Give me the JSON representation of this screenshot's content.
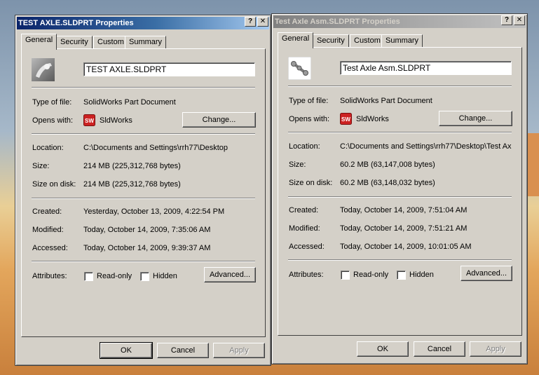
{
  "dialogs": [
    {
      "title": "TEST AXLE.SLDPRT Properties",
      "active": true,
      "tabs": [
        "General",
        "Security",
        "Custom",
        "Summary"
      ],
      "file_name": "TEST AXLE.SLDPRT",
      "file_icon": "part-thumbnail-icon",
      "type_label": "Type of file:",
      "type_value": "SolidWorks Part Document",
      "opens_label": "Opens with:",
      "opens_value": "SldWorks",
      "change_label": "Change...",
      "location_label": "Location:",
      "location_value": "C:\\Documents and Settings\\rrh77\\Desktop",
      "size_label": "Size:",
      "size_value": "214 MB (225,312,768 bytes)",
      "size_disk_label": "Size on disk:",
      "size_disk_value": "214 MB (225,312,768 bytes)",
      "created_label": "Created:",
      "created_value": "Yesterday, October 13, 2009, 4:22:54 PM",
      "modified_label": "Modified:",
      "modified_value": "Today, October 14, 2009, 7:35:06 AM",
      "accessed_label": "Accessed:",
      "accessed_value": "Today, October 14, 2009, 9:39:37 AM",
      "attributes_label": "Attributes:",
      "readonly_label": "Read-only",
      "hidden_label": "Hidden",
      "advanced_label": "Advanced...",
      "ok_label": "OK",
      "cancel_label": "Cancel",
      "apply_label": "Apply"
    },
    {
      "title": "Test Axle Asm.SLDPRT Properties",
      "active": false,
      "tabs": [
        "General",
        "Security",
        "Custom",
        "Summary"
      ],
      "file_name": "Test Axle Asm.SLDPRT",
      "file_icon": "assembly-thumbnail-icon",
      "type_label": "Type of file:",
      "type_value": "SolidWorks Part Document",
      "opens_label": "Opens with:",
      "opens_value": "SldWorks",
      "change_label": "Change...",
      "location_label": "Location:",
      "location_value": "C:\\Documents and Settings\\rrh77\\Desktop\\Test Ax",
      "size_label": "Size:",
      "size_value": "60.2 MB (63,147,008 bytes)",
      "size_disk_label": "Size on disk:",
      "size_disk_value": "60.2 MB (63,148,032 bytes)",
      "created_label": "Created:",
      "created_value": "Today, October 14, 2009, 7:51:04 AM",
      "modified_label": "Modified:",
      "modified_value": "Today, October 14, 2009, 7:51:21 AM",
      "accessed_label": "Accessed:",
      "accessed_value": "Today, October 14, 2009, 10:01:05 AM",
      "attributes_label": "Attributes:",
      "readonly_label": "Read-only",
      "hidden_label": "Hidden",
      "advanced_label": "Advanced...",
      "ok_label": "OK",
      "cancel_label": "Cancel",
      "apply_label": "Apply"
    }
  ],
  "titlebar_buttons": {
    "help": "?",
    "close": "✕"
  },
  "colors": {
    "active_title": "#0a246a",
    "inactive_title": "#808080",
    "dialog_face": "#d4d0c8",
    "sw_icon": "#cc2222"
  }
}
